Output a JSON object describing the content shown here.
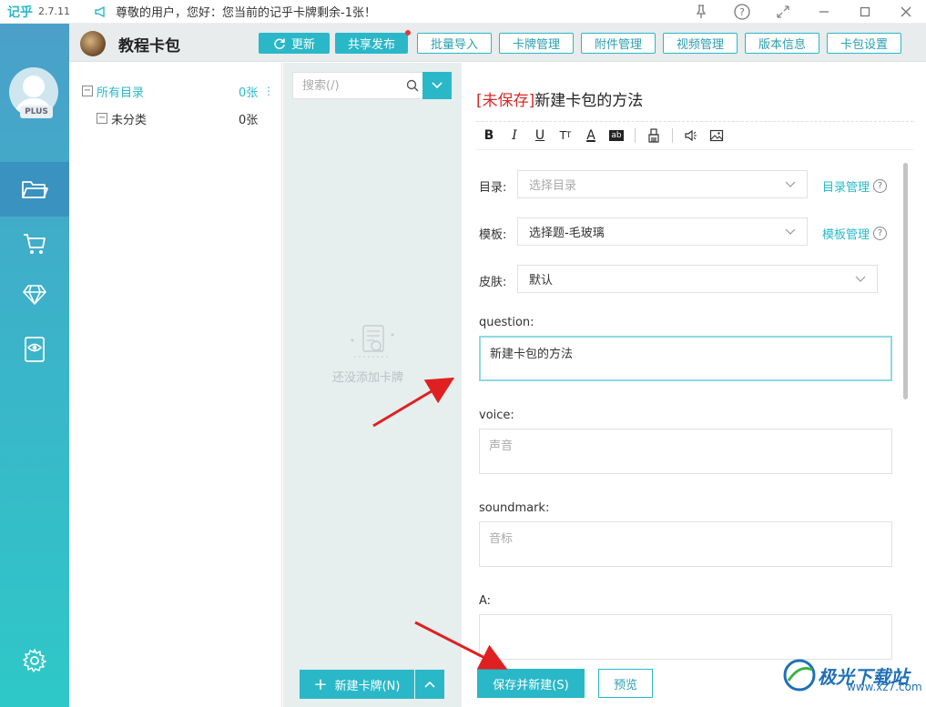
{
  "app": {
    "logo": "记乎",
    "version": "2.7.11",
    "notice": "尊敬的用户，您好：您当前的记乎卡牌剩余-1张！"
  },
  "window_controls": [
    "pin-icon",
    "help-icon",
    "fullscreen-icon",
    "minimize-icon",
    "maximize-icon",
    "close-icon"
  ],
  "sidebar": {
    "badge": "PLUS",
    "items": [
      {
        "icon": "folder-icon",
        "active": true
      },
      {
        "icon": "cart-icon",
        "active": false
      },
      {
        "icon": "diamond-icon",
        "active": false
      },
      {
        "icon": "eye-icon",
        "active": false
      }
    ],
    "bottom_icon": "settings-icon"
  },
  "header": {
    "pack_name": "教程卡包",
    "buttons": {
      "update": "更新",
      "share": "共享发布",
      "batch_import": "批量导入",
      "card_manage": "卡牌管理",
      "attach_manage": "附件管理",
      "video_manage": "视频管理",
      "version_info": "版本信息",
      "pack_settings": "卡包设置"
    }
  },
  "tree": {
    "all": {
      "label": "所有目录",
      "count": "0张"
    },
    "uncategorized": {
      "label": "未分类",
      "count": "0张"
    }
  },
  "card_list": {
    "search_placeholder": "搜索(/)",
    "empty_text": "还没添加卡牌",
    "new_card": "新建卡牌(N)"
  },
  "editor": {
    "unsaved": "[未保存]",
    "title": "新建卡包的方法",
    "directory": {
      "label": "目录:",
      "placeholder": "选择目录",
      "link": "目录管理"
    },
    "template": {
      "label": "模板:",
      "value": "选择题-毛玻璃",
      "link": "模板管理"
    },
    "skin": {
      "label": "皮肤:",
      "value": "默认"
    },
    "fields": [
      {
        "label": "question:",
        "value": "新建卡包的方法"
      },
      {
        "label": "voice:",
        "value": "声音"
      },
      {
        "label": "soundmark:",
        "value": "音标"
      },
      {
        "label": "A:",
        "value": ""
      }
    ],
    "save_new": "保存并新建(S)",
    "preview": "预览"
  },
  "watermark": {
    "text": "极光下载站",
    "sub": "www.xz7.com"
  },
  "colors": {
    "accent": "#2ab8c8",
    "unsaved": "#d82a2a",
    "annotation_arrow": "#e02020"
  }
}
